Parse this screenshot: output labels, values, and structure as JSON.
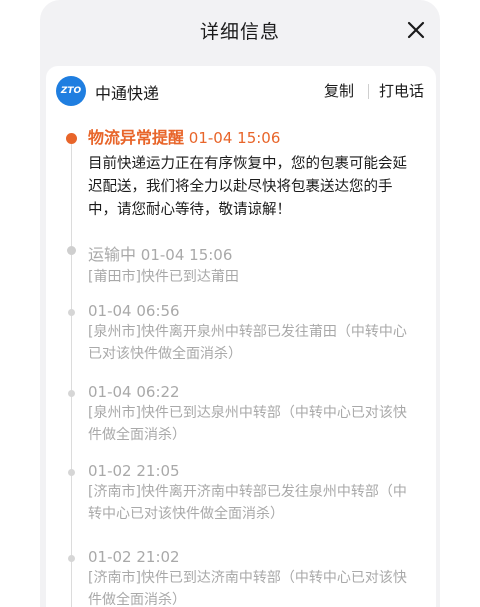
{
  "header": {
    "title": "详细信息",
    "close_icon": "close-icon"
  },
  "carrier": {
    "logo_text": "ZTO",
    "name": "中通快递",
    "copy_label": "复制",
    "call_label": "打电话"
  },
  "colors": {
    "alert": "#e8652a",
    "muted": "#a9a9a9",
    "text": "#1b1b1b",
    "brand": "#1f7ee0"
  },
  "events": [
    {
      "status": "物流异常提醒",
      "time": "01-04 15:06",
      "text": "目前快递运力正在有序恢复中，您的包裹可能会延迟配送，我们将全力以赴尽快将包裹送达您的手中，请您耐心等待，敬请谅解！"
    },
    {
      "status": "运输中",
      "time": "01-04 15:06",
      "text": "[莆田市]快件已到达莆田"
    },
    {
      "status": "",
      "time": "01-04 06:56",
      "text": "[泉州市]快件离开泉州中转部已发往莆田（中转中心已对该快件做全面消杀）"
    },
    {
      "status": "",
      "time": "01-04 06:22",
      "text": "[泉州市]快件已到达泉州中转部（中转中心已对该快件做全面消杀）"
    },
    {
      "status": "",
      "time": "01-02 21:05",
      "text": "[济南市]快件离开济南中转部已发往泉州中转部（中转中心已对该快件做全面消杀）"
    },
    {
      "status": "",
      "time": "01-02 21:02",
      "text": "[济南市]快件已到达济南中转部（中转中心已对该快件做全面消杀）"
    }
  ]
}
